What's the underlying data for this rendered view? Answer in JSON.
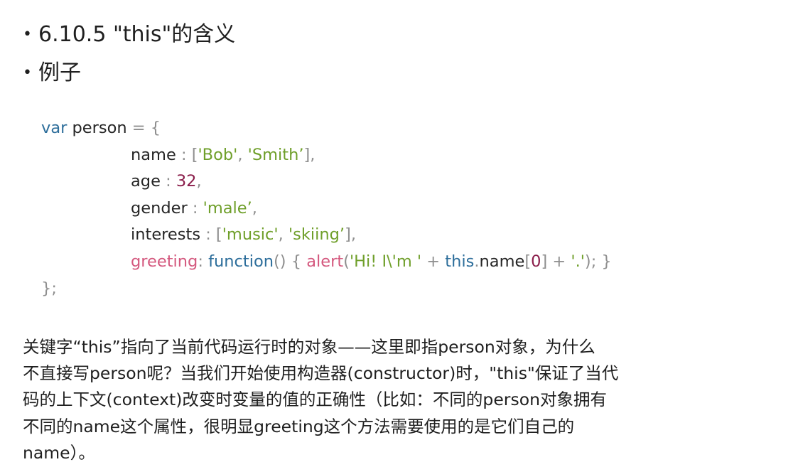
{
  "bullets": [
    "6.10.5 \"this\"的含义",
    "例子"
  ],
  "code": {
    "l1": {
      "kw": "var",
      "name": " person ",
      "op": "= {"
    },
    "l2": {
      "key": "name",
      "sep": " : [",
      "s1": "'Bob'",
      "comma": ", ",
      "s2": "'Smith’",
      "end": "],"
    },
    "l3": {
      "key": "age",
      "sep": " : ",
      "num": "32",
      "end": ","
    },
    "l4": {
      "key": "gender",
      "sep": " : ",
      "s1": "'male’",
      "end": ","
    },
    "l5": {
      "key": "interests",
      "sep": " : [",
      "s1": "'music'",
      "comma": ", ",
      "s2": "'skiing’",
      "end": "],"
    },
    "l6": {
      "key": "greeting",
      "colon": ": ",
      "fn": "function",
      "paren": "() { ",
      "alert": "alert",
      "open": "(",
      "s1": "'Hi! I\\'m '",
      "plus1": " + ",
      "this": "this",
      "dot": ".",
      "prop": "name",
      "lb": "[",
      "idx": "0",
      "rb": "]",
      "plus2": " + ",
      "s2": "'.'",
      "close": "); }"
    },
    "l7": "};"
  },
  "paragraph": [
    "关键字“this”指向了当前代码运行时的对象——这里即指person对象，为什么",
    "不直接写person呢？当我们开始使用构造器(constructor)时，\"this\"保证了当代",
    "码的上下文(context)改变时变量的值的正确性（比如：不同的person对象拥有",
    "不同的name这个属性，很明显greeting这个方法需要使用的是它们自己的",
    "name）。"
  ]
}
